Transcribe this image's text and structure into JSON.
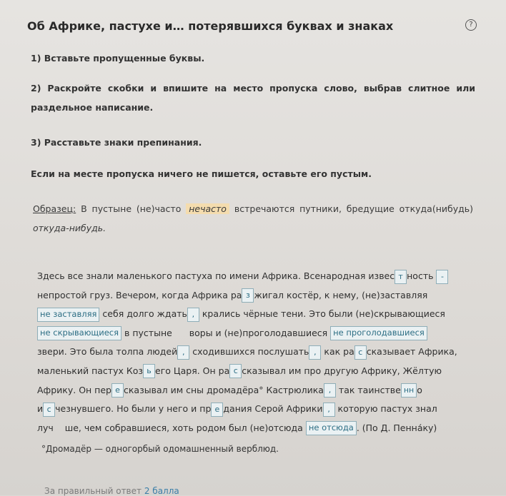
{
  "title": "Об Африке, пастухе и… потерявшихся буквах и знаках",
  "help_icon": "?",
  "instructions": [
    "1) Вставьте пропущенные буквы.",
    "2) Раскройте скобки и впишите на место пропуска слово, выбрав слитное или раздельное написание.",
    "3) Расставьте знаки препинания.",
    "Если на месте пропуска ничего не пишется, оставьте его пустым."
  ],
  "sample": {
    "label": "Образец:",
    "t1": "В пустыне (не)часто",
    "ans1": "нечасто",
    "t2": "встречаются путники, бредущие",
    "t3": "откуда(нибудь)",
    "ans2": "откуда-нибудь."
  },
  "lines": [
    [
      {
        "t": "Здесь все знали маленького пастуха по имени Африка. Всенародная извес"
      },
      {
        "b": "т"
      },
      {
        "t": "ность "
      },
      {
        "b": "-"
      }
    ],
    [
      {
        "t": "непростой груз. Вечером, когда Африка ра"
      },
      {
        "b": "з"
      },
      {
        "t": "жигал костёр, к нему, (не)заставляя"
      }
    ],
    [
      {
        "b": "не заставляя",
        "w": 1
      },
      {
        "t": " себя долго ждать"
      },
      {
        "b": ","
      },
      {
        "t": " крались чёрные тени. Это были (не)скрывающиеся"
      }
    ],
    [
      {
        "b": "не скрывающиеся",
        "w": 1
      },
      {
        "t": " в пустыне "
      },
      {
        "e": 1
      },
      {
        "t": " воры и (не)проголодавшиеся "
      },
      {
        "b": "не проголодавшиеся",
        "w": 1
      }
    ],
    [
      {
        "t": "звери. Это была толпа людей"
      },
      {
        "b": ","
      },
      {
        "t": " сходившихся послушать"
      },
      {
        "b": ","
      },
      {
        "t": " как ра"
      },
      {
        "b": "с"
      },
      {
        "t": "сказывает Африка,"
      }
    ],
    [
      {
        "t": "маленький пастух Коз"
      },
      {
        "b": "ь"
      },
      {
        "t": "его Царя. Он ра"
      },
      {
        "b": "с"
      },
      {
        "t": "сказывал им про другую Африку, Жёлтую"
      }
    ],
    [
      {
        "t": "Африку. Он пер"
      },
      {
        "b": "е"
      },
      {
        "t": "сказывал им сны дромадёра° Кастрюлика"
      },
      {
        "b": ","
      },
      {
        "t": " так таинстве"
      },
      {
        "b": "нн"
      },
      {
        "t": "о"
      }
    ],
    [
      {
        "t": "и"
      },
      {
        "b": "с"
      },
      {
        "t": "чезнувшего. Но были у него и пр"
      },
      {
        "b": "е"
      },
      {
        "t": "дания Серой Африки"
      },
      {
        "b": ","
      },
      {
        "t": " которую пастух знал"
      }
    ],
    [
      {
        "t": "луч"
      },
      {
        "e": 1
      },
      {
        "t": "ше, чем собравшиеся, хоть родом был (не)отсюда "
      },
      {
        "b": "не отсюда",
        "w": 1
      },
      {
        "t": ". (По Д. Пенна́ку)"
      }
    ]
  ],
  "footnote": "°Дромадёр — одногорбый одомашненный верблюд.",
  "footer": {
    "prefix": "За правильный ответ",
    "points": "2 балла"
  }
}
